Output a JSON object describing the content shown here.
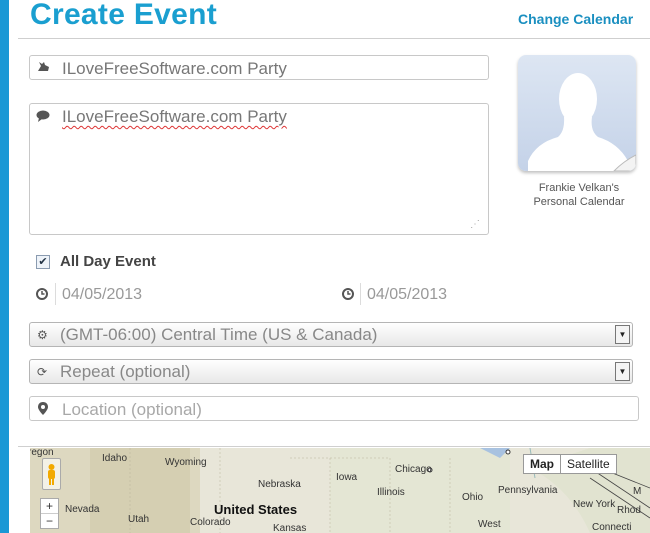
{
  "header": {
    "title": "Create Event",
    "change_calendar": "Change Calendar"
  },
  "event": {
    "title_value": "ILoveFreeSoftware.com Party",
    "description_value": "ILoveFreeSoftware.com Party",
    "all_day_label": "All Day Event",
    "all_day_checked": true,
    "start_date": "04/05/2013",
    "end_date": "04/05/2013"
  },
  "calendar": {
    "owner_line1": "Frankie Velkan's",
    "owner_line2": "Personal Calendar"
  },
  "timezone": {
    "selected": "(GMT-06:00) Central Time (US & Canada)"
  },
  "repeat": {
    "selected": "Repeat (optional)"
  },
  "location": {
    "placeholder": "Location (optional)"
  },
  "map": {
    "mode_map": "Map",
    "mode_satellite": "Satellite",
    "zoom_in": "+",
    "zoom_out": "−",
    "labels": {
      "oregon": "regon",
      "idaho": "Idaho",
      "wyoming": "Wyoming",
      "chicago": "Chicago",
      "nebraska": "Nebraska",
      "iowa": "Iowa",
      "illinois": "Illinois",
      "ohio": "Ohio",
      "pennsylvania": "Pennsylvania",
      "new_york": "New York",
      "rhode": "Rhod",
      "nevada": "Nevada",
      "utah": "Utah",
      "colorado": "Colorado",
      "kansas": "Kansas",
      "west": "West",
      "connecticut": "Connecti",
      "united_states": "United States",
      "maine_partial": "M"
    }
  },
  "colors": {
    "accent": "#1a9fd0",
    "left_bar": "#1a98d5"
  }
}
